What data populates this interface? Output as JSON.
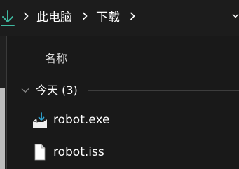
{
  "breadcrumb": {
    "items": [
      "此电脑",
      "下载"
    ]
  },
  "details": {
    "column_name": "名称"
  },
  "group": {
    "title": "今天 (3)"
  },
  "files": [
    {
      "name": "robot.exe",
      "icon": "installer-icon"
    },
    {
      "name": "robot.iss",
      "icon": "document-icon"
    }
  ],
  "colors": {
    "accent": "#2ea8d8",
    "download_icon": "#3fb9a0",
    "background": "#191919"
  }
}
